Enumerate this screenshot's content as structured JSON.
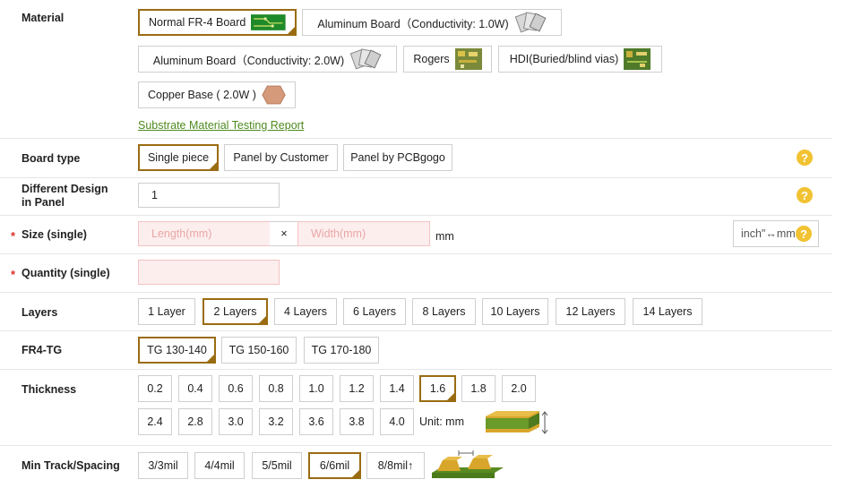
{
  "material": {
    "label": "Material",
    "options": [
      {
        "label": "Normal FR-4 Board",
        "selected": true
      },
      {
        "label": "Aluminum Board（Conductivity: 1.0W)",
        "selected": false
      },
      {
        "label": "Aluminum Board（Conductivity: 2.0W)",
        "selected": false
      },
      {
        "label": "Rogers",
        "selected": false
      },
      {
        "label": "HDI(Buried/blind vias)",
        "selected": false
      },
      {
        "label": "Copper Base ( 2.0W )",
        "selected": false
      }
    ],
    "report_link": "Substrate Material Testing Report"
  },
  "board_type": {
    "label": "Board type",
    "options": [
      "Single piece",
      "Panel by Customer",
      "Panel by PCBgogo"
    ],
    "selected": "Single piece"
  },
  "different_design": {
    "label_line1": "Different Design",
    "label_line2": "in Panel",
    "value": "1"
  },
  "size": {
    "required_mark": "*",
    "label": "Size (single)",
    "length_placeholder": "Length(mm)",
    "times": "×",
    "width_placeholder": "Width(mm)",
    "unit": "mm",
    "convert_button": "inch\"↔mm"
  },
  "quantity": {
    "required_mark": "*",
    "label": "Quantity (single)",
    "value": ""
  },
  "layers": {
    "label": "Layers",
    "options": [
      "1 Layer",
      "2 Layers",
      "4 Layers",
      "6 Layers",
      "8 Layers",
      "10 Layers",
      "12 Layers",
      "14 Layers"
    ],
    "selected": "2 Layers"
  },
  "fr4_tg": {
    "label": "FR4-TG",
    "options": [
      "TG 130-140",
      "TG 150-160",
      "TG 170-180"
    ],
    "selected": "TG 130-140"
  },
  "thickness": {
    "label": "Thickness",
    "row1": [
      "0.2",
      "0.4",
      "0.6",
      "0.8",
      "1.0",
      "1.2",
      "1.4",
      "1.6",
      "1.8",
      "2.0"
    ],
    "row2": [
      "2.4",
      "2.8",
      "3.0",
      "3.2",
      "3.6",
      "3.8",
      "4.0"
    ],
    "selected": "1.6",
    "unit_text": "Unit: mm"
  },
  "track": {
    "label": "Min Track/Spacing",
    "options": [
      "3/3mil",
      "4/4mil",
      "5/5mil",
      "6/6mil",
      "8/8mil↑"
    ],
    "selected": "6/6mil"
  },
  "help_glyph": "?",
  "colors": {
    "selected_border": "#9a6c12",
    "help": "#f1c232",
    "link": "#4d8a1f",
    "required": "#d9302a"
  }
}
